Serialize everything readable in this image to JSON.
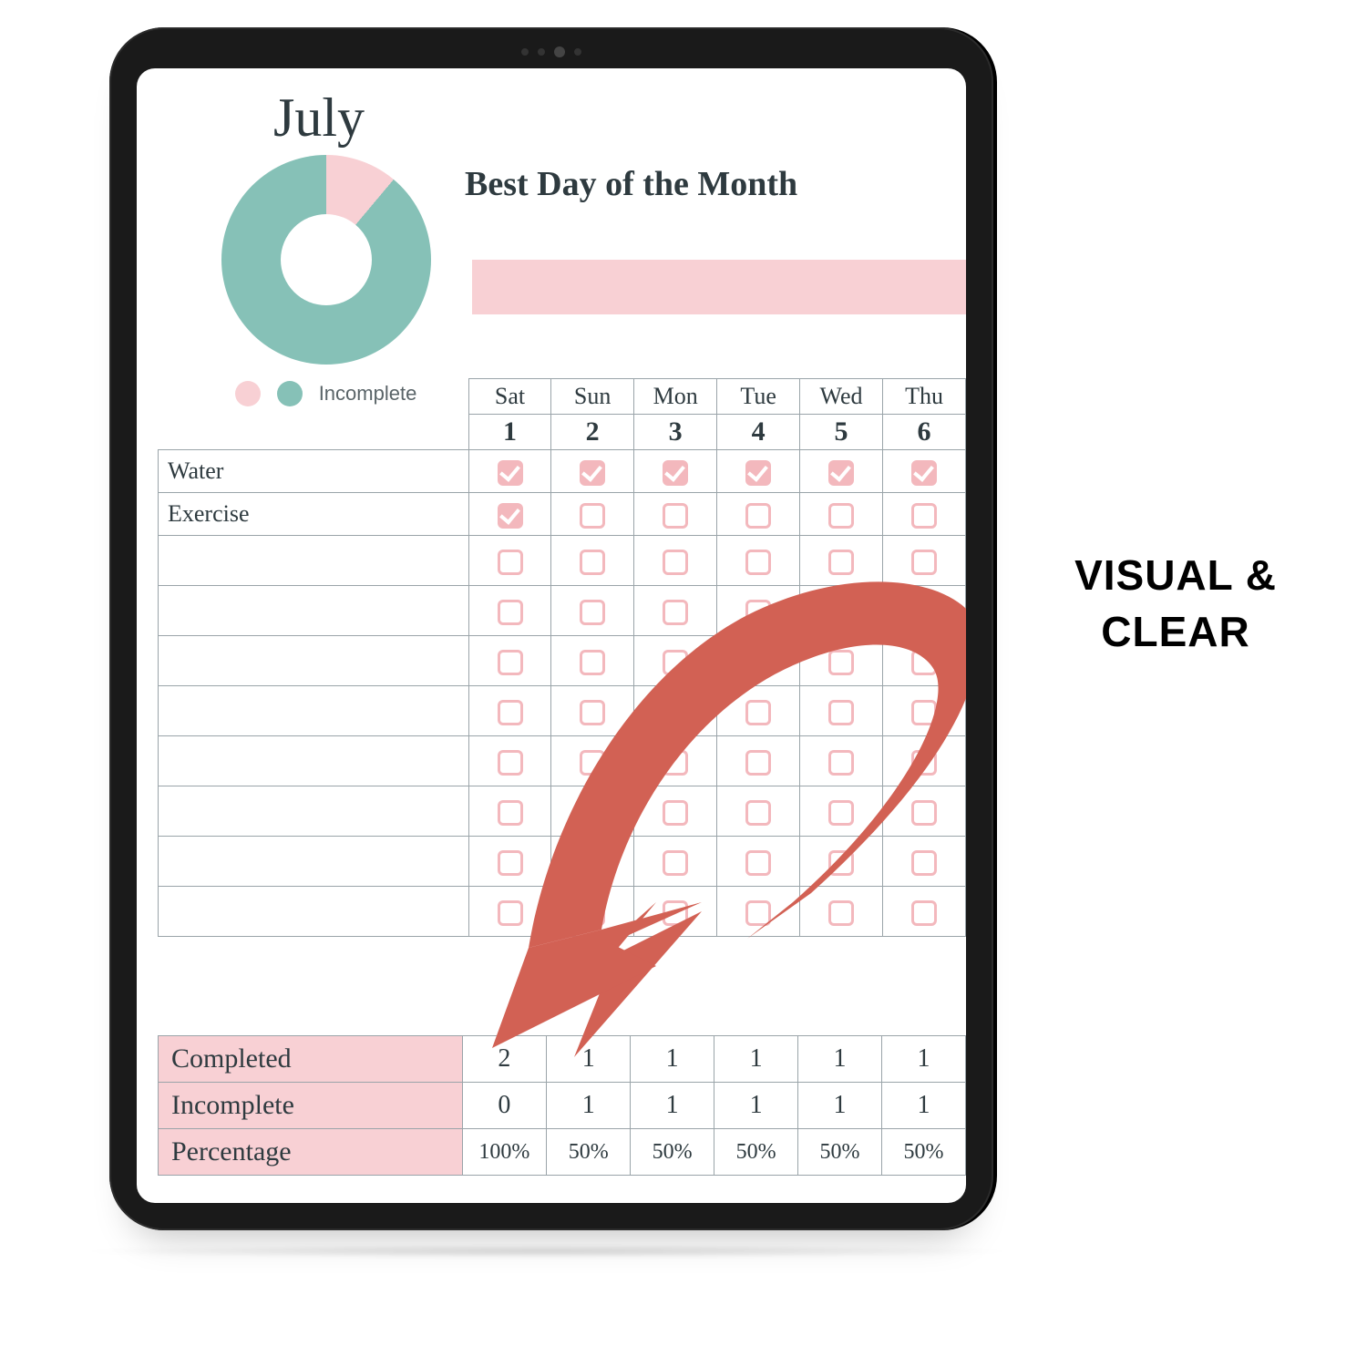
{
  "month": "July",
  "subtitle": "Best Day of the Month",
  "legend_label": "Incomplete",
  "chart_data": {
    "type": "pie",
    "title": "July completion",
    "series": [
      {
        "name": "Incomplete",
        "value": 11,
        "color": "#f8d0d4"
      },
      {
        "name": "Complete",
        "value": 89,
        "color": "#86c1b7"
      }
    ]
  },
  "days": [
    "Sat",
    "Sun",
    "Mon",
    "Tue",
    "Wed",
    "Thu"
  ],
  "dates": [
    "1",
    "2",
    "3",
    "4",
    "5",
    "6"
  ],
  "habits": [
    {
      "name": "Water",
      "checks": [
        true,
        true,
        true,
        true,
        true,
        true
      ]
    },
    {
      "name": "Exercise",
      "checks": [
        true,
        false,
        false,
        false,
        false,
        false
      ]
    },
    {
      "name": "",
      "checks": [
        false,
        false,
        false,
        false,
        false,
        false
      ]
    },
    {
      "name": "",
      "checks": [
        false,
        false,
        false,
        false,
        false,
        false
      ]
    },
    {
      "name": "",
      "checks": [
        false,
        false,
        false,
        false,
        false,
        false
      ]
    },
    {
      "name": "",
      "checks": [
        false,
        false,
        false,
        false,
        false,
        false
      ]
    },
    {
      "name": "",
      "checks": [
        false,
        false,
        false,
        false,
        false,
        false
      ]
    },
    {
      "name": "",
      "checks": [
        false,
        false,
        false,
        false,
        false,
        false
      ]
    },
    {
      "name": "",
      "checks": [
        false,
        false,
        false,
        false,
        false,
        false
      ]
    },
    {
      "name": "",
      "checks": [
        false,
        false,
        false,
        false,
        false,
        false
      ]
    }
  ],
  "summary": {
    "rows": [
      {
        "label": "Completed",
        "values": [
          "2",
          "1",
          "1",
          "1",
          "1",
          "1"
        ]
      },
      {
        "label": "Incomplete",
        "values": [
          "0",
          "1",
          "1",
          "1",
          "1",
          "1"
        ]
      },
      {
        "label": "Percentage",
        "values": [
          "100%",
          "50%",
          "50%",
          "50%",
          "50%",
          "50%"
        ]
      }
    ]
  },
  "caption_line1": "VISUAL &",
  "caption_line2": "CLEAR",
  "colors": {
    "pink": "#f5c2c7",
    "teal": "#86c1b7",
    "arrow": "#d26154"
  }
}
